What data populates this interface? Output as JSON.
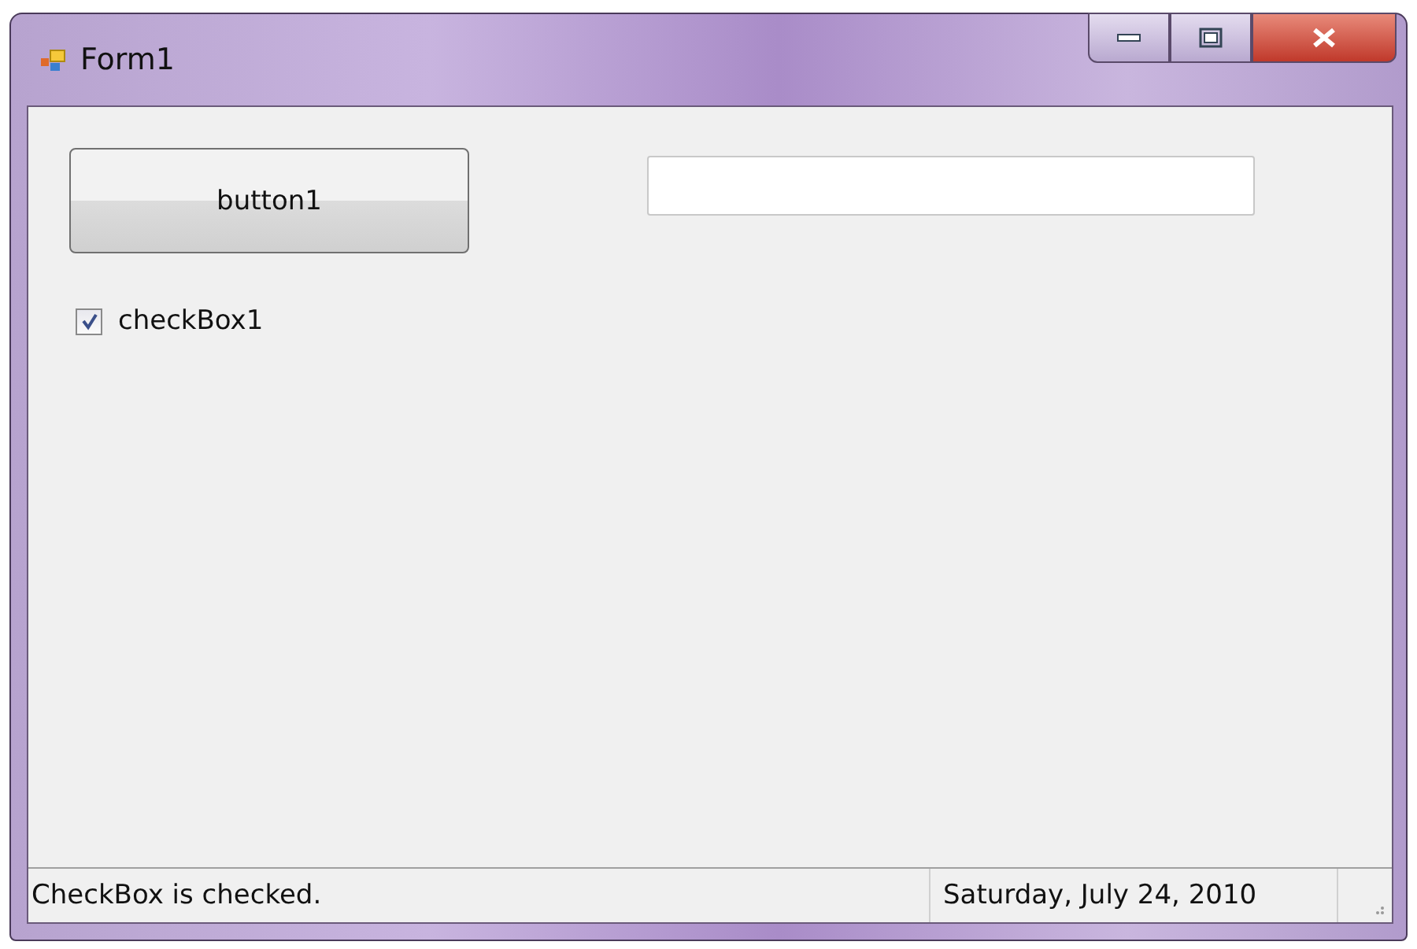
{
  "window": {
    "title": "Form1"
  },
  "button": {
    "label": "button1"
  },
  "checkbox": {
    "label": "checkBox1",
    "checked": true
  },
  "status_bar": {
    "message": "CheckBox is checked.",
    "date": "Saturday, July 24, 2010"
  }
}
